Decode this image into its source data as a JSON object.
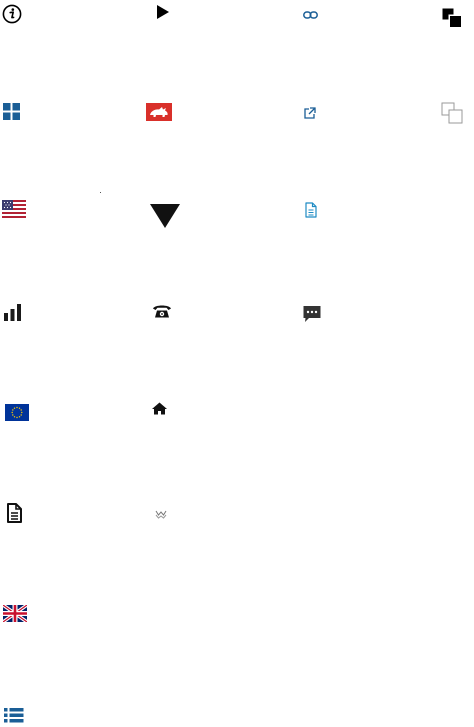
{
  "colors": {
    "black": "#000000",
    "dark": "#1a1a1a",
    "blue": "#1a5e96",
    "sky": "#1e8bc3",
    "red": "#d9302a",
    "gray": "#9a9a9a",
    "flag_red": "#b22234",
    "flag_blue": "#3c3b6e",
    "eu_blue": "#003399",
    "eu_gold": "#ffcc00",
    "uk_blue": "#012169",
    "uk_red": "#c8102e",
    "chat": "#333333"
  },
  "icons": [
    {
      "name": "info-icon"
    },
    {
      "name": "play-icon"
    },
    {
      "name": "link-icon"
    },
    {
      "name": "copy-filled-icon"
    },
    {
      "name": "grid-icon"
    },
    {
      "name": "rhino-badge-icon"
    },
    {
      "name": "external-link-icon"
    },
    {
      "name": "copy-outline-icon"
    },
    {
      "name": "us-flag-icon"
    },
    {
      "name": "triangle-down-icon"
    },
    {
      "name": "document-outline-icon"
    },
    {
      "name": "signal-bars-icon"
    },
    {
      "name": "telephone-icon"
    },
    {
      "name": "chat-bubble-icon"
    },
    {
      "name": "eu-flag-icon"
    },
    {
      "name": "home-icon"
    },
    {
      "name": "document-filled-icon"
    },
    {
      "name": "wave-icon"
    },
    {
      "name": "uk-flag-icon"
    },
    {
      "name": "list-icon"
    }
  ]
}
